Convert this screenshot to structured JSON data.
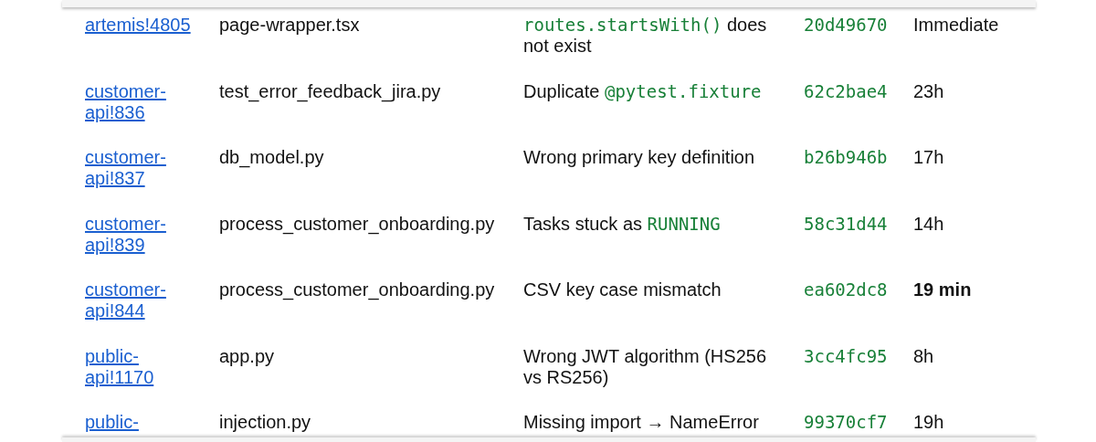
{
  "rows": [
    {
      "mr": "artemis!4805",
      "file": "page-wrapper.tsx",
      "issue": [
        {
          "kind": "code",
          "text": "routes.startsWith()"
        },
        {
          "kind": "text",
          "text": " does not exist"
        }
      ],
      "commit": "20d49670",
      "time": "Immediate",
      "bold": false
    },
    {
      "mr": "customer-api!836",
      "file": "test_error_feedback_jira.py",
      "issue": [
        {
          "kind": "text",
          "text": "Duplicate "
        },
        {
          "kind": "code",
          "text": "@pytest.fixture"
        }
      ],
      "commit": "62c2bae4",
      "time": "23h",
      "bold": false
    },
    {
      "mr": "customer-api!837",
      "file": "db_model.py",
      "issue": [
        {
          "kind": "text",
          "text": "Wrong primary key definition"
        }
      ],
      "commit": "b26b946b",
      "time": "17h",
      "bold": false
    },
    {
      "mr": "customer-api!839",
      "file": "process_customer_onboarding.py",
      "issue": [
        {
          "kind": "text",
          "text": "Tasks stuck as "
        },
        {
          "kind": "code",
          "text": "RUNNING"
        }
      ],
      "commit": "58c31d44",
      "time": "14h",
      "bold": false
    },
    {
      "mr": "customer-api!844",
      "file": "process_customer_onboarding.py",
      "issue": [
        {
          "kind": "text",
          "text": "CSV key case mismatch"
        }
      ],
      "commit": "ea602dc8",
      "time": "19 min",
      "bold": true
    },
    {
      "mr": "public-api!1170",
      "file": "app.py",
      "issue": [
        {
          "kind": "text",
          "text": "Wrong JWT algorithm (HS256 vs RS256)"
        }
      ],
      "commit": "3cc4fc95",
      "time": "8h",
      "bold": false
    },
    {
      "mr": "public-",
      "file": "injection.py",
      "issue": [
        {
          "kind": "text",
          "text": "Missing import → NameError"
        }
      ],
      "commit": "99370cf7",
      "time": "19h",
      "bold": false
    }
  ]
}
